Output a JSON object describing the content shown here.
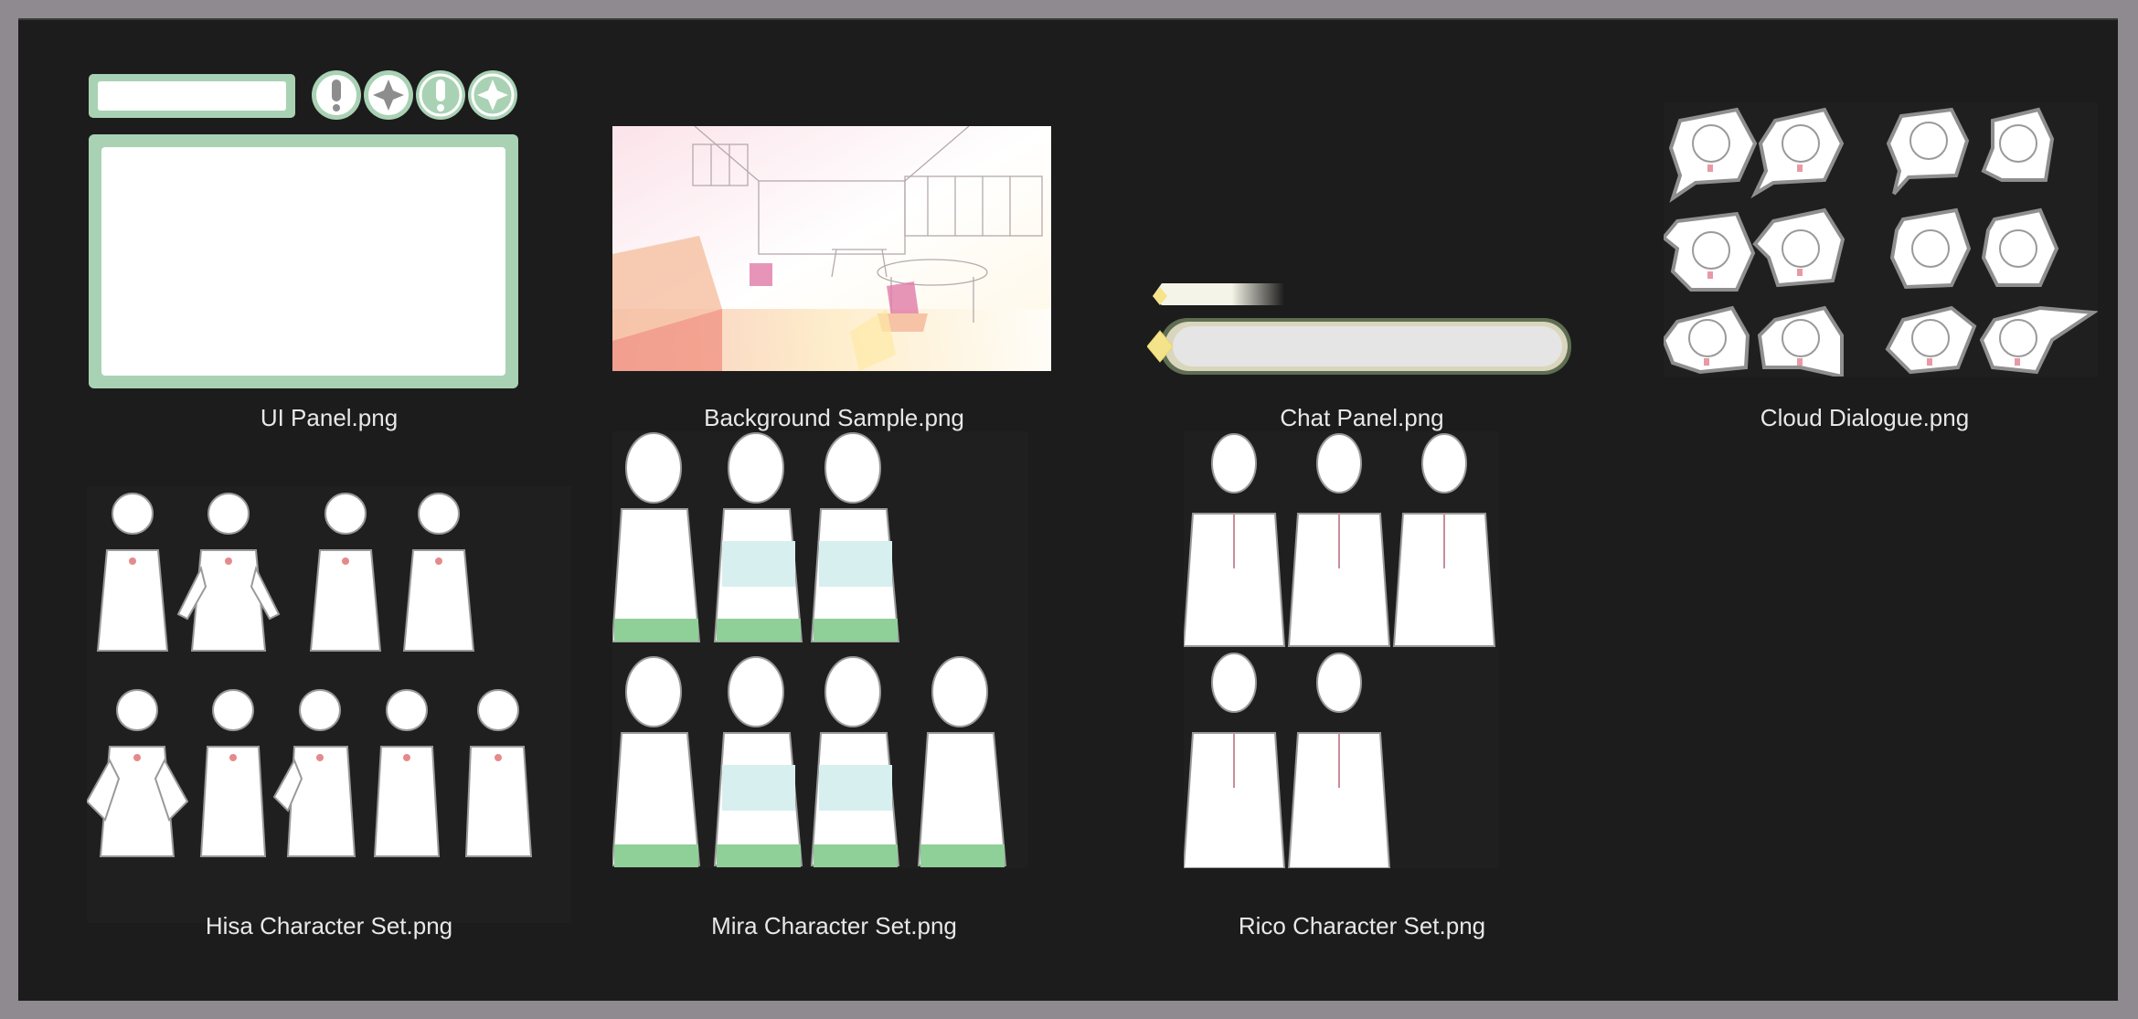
{
  "colors": {
    "background": "#1c1c1c",
    "frame": "#8f8a90",
    "caption": "#e8e8e8",
    "ui_green": "#a9d2b4",
    "ui_green_dark": "#8bb99a"
  },
  "files": [
    {
      "name": "UI Panel.png",
      "icon": "ui-panel-thumbnail"
    },
    {
      "name": "Background Sample.png",
      "icon": "classroom-background-thumbnail"
    },
    {
      "name": "Chat Panel.png",
      "icon": "chat-panel-thumbnail"
    },
    {
      "name": "Cloud Dialogue.png",
      "icon": "speech-bubbles-thumbnail"
    },
    {
      "name": "Hisa Character Set.png",
      "icon": "character-sprites-thumbnail"
    },
    {
      "name": "Mira Character Set.png",
      "icon": "character-sprites-thumbnail"
    },
    {
      "name": "Rico Character Set.png",
      "icon": "character-sprites-thumbnail"
    }
  ]
}
